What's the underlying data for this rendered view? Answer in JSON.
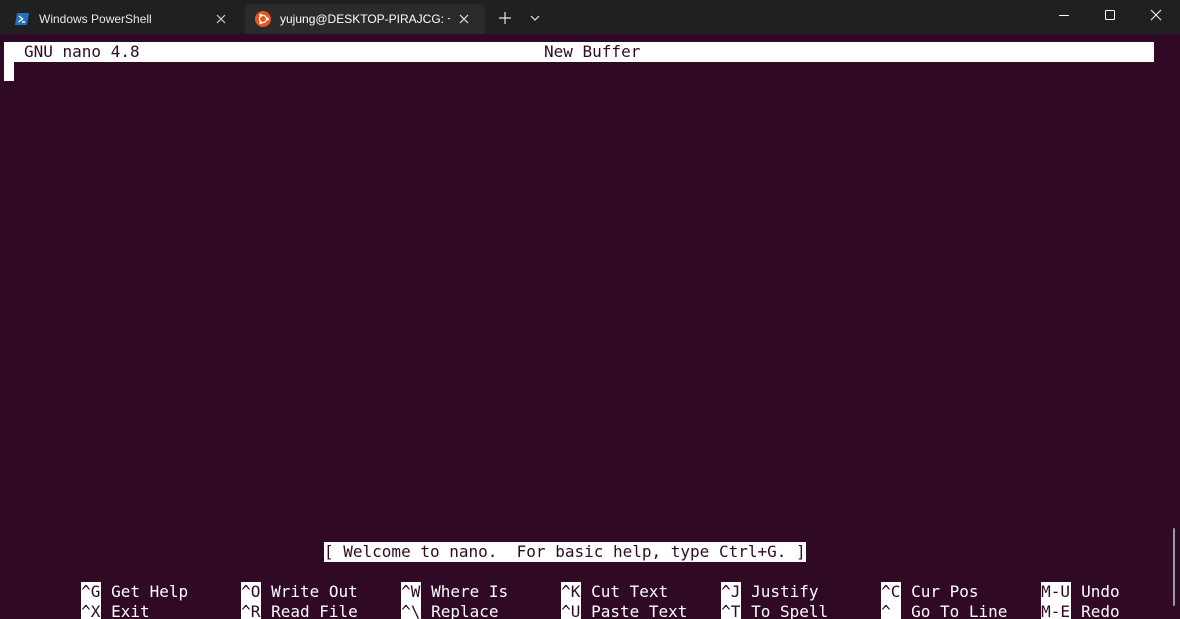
{
  "tabs": [
    {
      "label": "Windows PowerShell",
      "icon": "powershell-icon",
      "active": false
    },
    {
      "label": "yujung@DESKTOP-PIRAJCG: ~",
      "icon": "ubuntu-icon",
      "active": true
    }
  ],
  "nano": {
    "version_label": "GNU nano 4.8",
    "buffer_name": "New Buffer",
    "status_message": "[ Welcome to nano.  For basic help, type Ctrl+G. ]"
  },
  "shortcuts": {
    "row1": [
      {
        "key": "^G",
        "label": "Get Help"
      },
      {
        "key": "^O",
        "label": "Write Out"
      },
      {
        "key": "^W",
        "label": "Where Is"
      },
      {
        "key": "^K",
        "label": "Cut Text"
      },
      {
        "key": "^J",
        "label": "Justify"
      },
      {
        "key": "^C",
        "label": "Cur Pos"
      },
      {
        "key": "M-U",
        "label": "Undo"
      }
    ],
    "row2": [
      {
        "key": "^X",
        "label": "Exit"
      },
      {
        "key": "^R",
        "label": "Read File"
      },
      {
        "key": "^\\",
        "label": "Replace"
      },
      {
        "key": "^U",
        "label": "Paste Text"
      },
      {
        "key": "^T",
        "label": "To Spell"
      },
      {
        "key": "^_",
        "label": "Go To Line"
      },
      {
        "key": "M-E",
        "label": "Redo"
      }
    ]
  },
  "colors": {
    "terminal_bg": "#300a24",
    "tabbar_bg": "#202020",
    "active_tab_bg": "#2b2b2b",
    "ubuntu_orange": "#e95420",
    "powershell_blue": "#2671be"
  }
}
